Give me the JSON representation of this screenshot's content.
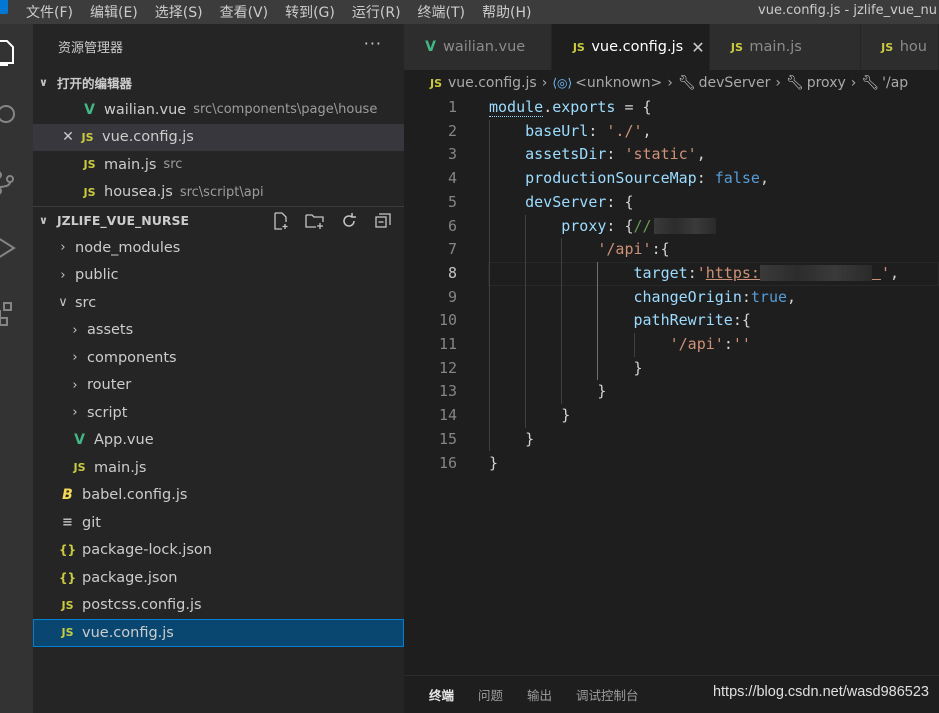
{
  "window": {
    "title": "vue.config.js - jzlife_vue_nu"
  },
  "menu": [
    "文件(F)",
    "编辑(E)",
    "选择(S)",
    "查看(V)",
    "转到(G)",
    "运行(R)",
    "终端(T)",
    "帮助(H)"
  ],
  "activity_icons": [
    "explorer-icon",
    "search-icon",
    "source-control-icon",
    "run-debug-icon",
    "extensions-icon"
  ],
  "sidebar": {
    "title": "资源管理器",
    "more": "···",
    "open_editors": {
      "title": "打开的编辑器",
      "items": [
        {
          "icon": "V",
          "type": "vue",
          "name": "wailian.vue",
          "desc": "src\\components\\page\\house"
        },
        {
          "icon": "JS",
          "type": "js",
          "name": "vue.config.js",
          "desc": ""
        },
        {
          "icon": "JS",
          "type": "js",
          "name": "main.js",
          "desc": "src"
        },
        {
          "icon": "JS",
          "type": "js",
          "name": "housea.js",
          "desc": "src\\script\\api"
        }
      ]
    },
    "project": {
      "title": "JZLIFE_VUE_NURSE",
      "items": [
        {
          "name": "node_modules",
          "kind": "folder",
          "depth": 0
        },
        {
          "name": "public",
          "kind": "folder",
          "depth": 0
        },
        {
          "name": "src",
          "kind": "folder-open",
          "depth": 0
        },
        {
          "name": "assets",
          "kind": "folder",
          "depth": 1
        },
        {
          "name": "components",
          "kind": "folder",
          "depth": 1
        },
        {
          "name": "router",
          "kind": "folder",
          "depth": 1
        },
        {
          "name": "script",
          "kind": "folder",
          "depth": 1
        },
        {
          "name": "App.vue",
          "kind": "vue",
          "depth": 1
        },
        {
          "name": "main.js",
          "kind": "js",
          "depth": 1
        },
        {
          "name": "babel.config.js",
          "kind": "babel",
          "depth": 0
        },
        {
          "name": "git",
          "kind": "git",
          "depth": 0
        },
        {
          "name": "package-lock.json",
          "kind": "json",
          "depth": 0
        },
        {
          "name": "package.json",
          "kind": "json",
          "depth": 0
        },
        {
          "name": "postcss.config.js",
          "kind": "js",
          "depth": 0
        },
        {
          "name": "vue.config.js",
          "kind": "js",
          "depth": 0
        }
      ]
    }
  },
  "tabs": [
    {
      "icon": "V",
      "type": "vue",
      "label": "wailian.vue"
    },
    {
      "icon": "JS",
      "type": "js",
      "label": "vue.config.js"
    },
    {
      "icon": "JS",
      "type": "js",
      "label": "main.js"
    },
    {
      "icon": "JS",
      "type": "js",
      "label": "hou"
    }
  ],
  "breadcrumb": [
    "vue.config.js",
    "<unknown>",
    "devServer",
    "proxy",
    "'/ap"
  ],
  "code": [
    "module.exports = {",
    "    baseUrl: './',",
    "    assetsDir: 'static',",
    "    productionSourceMap: false,",
    "    devServer: {",
    "        proxy: {//",
    "            '/api':{",
    "                target:'https:",
    "                changeOrigin:true,",
    "                pathRewrite:{",
    "                    '/api':''",
    "                }",
    "            }",
    "        }",
    "    }",
    "}"
  ],
  "line_numbers": [
    "1",
    "2",
    "3",
    "4",
    "5",
    "6",
    "7",
    "8",
    "9",
    "10",
    "11",
    "12",
    "13",
    "14",
    "15",
    "16"
  ],
  "panel": {
    "tabs": [
      "终端",
      "问题",
      "输出",
      "调试控制台"
    ],
    "watermark": "https://blog.csdn.net/wasd986523"
  }
}
